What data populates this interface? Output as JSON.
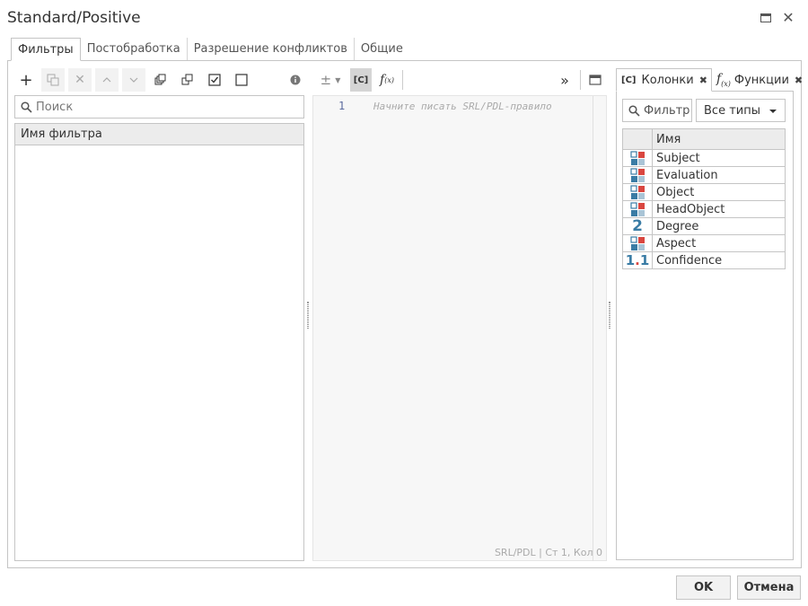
{
  "window": {
    "title": "Standard/Positive"
  },
  "tabs": [
    {
      "label": "Фильтры"
    },
    {
      "label": "Постобработка"
    },
    {
      "label": "Разрешение конфликтов"
    },
    {
      "label": "Общие"
    }
  ],
  "filters": {
    "search_placeholder": "Поиск",
    "column_header": "Имя фильтра"
  },
  "editor": {
    "line_number": "1",
    "placeholder": "Начните писать SRL/PDL-правило",
    "status": "SRL/PDL | Ст 1, Кол 0",
    "mode_label": "[C]"
  },
  "right_panel": {
    "tabs": [
      {
        "label": "Колонки",
        "icon": "[C]"
      },
      {
        "label": "Функции",
        "icon": "f(x)"
      }
    ],
    "filter_label": "Фильтр",
    "type_select": "Все типы",
    "table_header": "Имя",
    "columns": [
      {
        "name": "Subject",
        "type": "object"
      },
      {
        "name": "Evaluation",
        "type": "object"
      },
      {
        "name": "Object",
        "type": "object"
      },
      {
        "name": "HeadObject",
        "type": "object"
      },
      {
        "name": "Degree",
        "type": "integer"
      },
      {
        "name": "Aspect",
        "type": "object"
      },
      {
        "name": "Confidence",
        "type": "float"
      }
    ]
  },
  "footer": {
    "ok": "OK",
    "cancel": "Отмена"
  },
  "colors": {
    "accent_blue": "#3a7ca5",
    "accent_red": "#d9463f",
    "icon_light": "#a9c4d6"
  }
}
